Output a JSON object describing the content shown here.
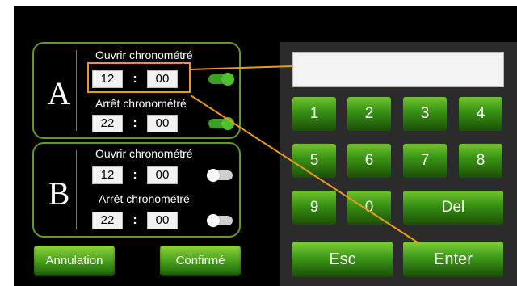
{
  "groups": [
    {
      "letter": "A",
      "open_label": "Ouvrir chronométré",
      "open_hour": "12",
      "open_min": "00",
      "open_toggle": "on",
      "stop_label": "Arrêt chronométré",
      "stop_hour": "22",
      "stop_min": "00",
      "stop_toggle": "on"
    },
    {
      "letter": "B",
      "open_label": "Ouvrir chronométré",
      "open_hour": "12",
      "open_min": "00",
      "open_toggle": "off",
      "stop_label": "Arrêt chronométré",
      "stop_hour": "22",
      "stop_min": "00",
      "stop_toggle": "off"
    }
  ],
  "colon": ":",
  "actions": {
    "cancel": "Annulation",
    "confirm": "Confirmé"
  },
  "keypad": {
    "display_value": "",
    "keys": [
      "1",
      "2",
      "3",
      "4",
      "5",
      "6",
      "7",
      "8",
      "9",
      "0"
    ],
    "del": "Del",
    "esc": "Esc",
    "enter": "Enter"
  },
  "colors": {
    "accent_green": "#3c9a17",
    "highlight": "#e59b1c"
  }
}
